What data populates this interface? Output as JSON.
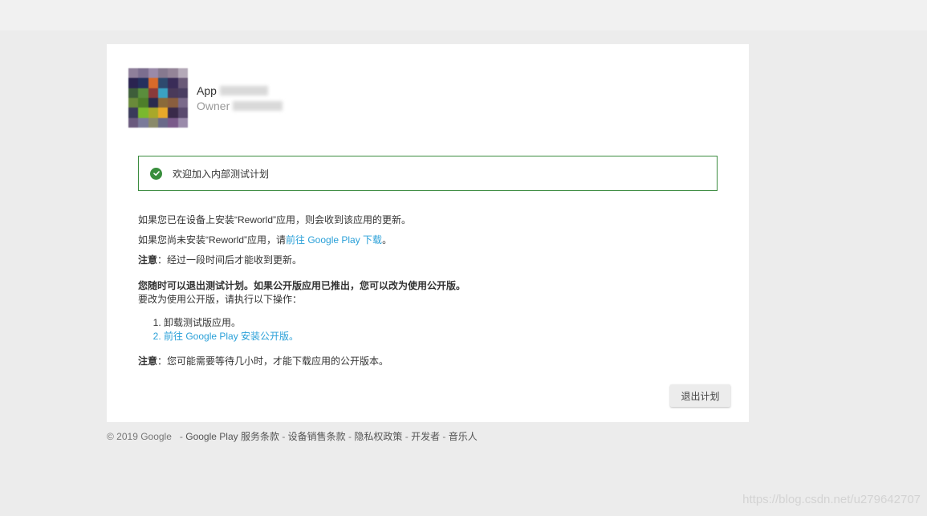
{
  "app": {
    "name": "App",
    "owner": "Owner",
    "icon_colors": [
      "#8e7f9a",
      "#7c6e8f",
      "#9a8aa8",
      "#86798f",
      "#948498",
      "#b4a9b8",
      "#2a2350",
      "#24305e",
      "#d86a2a",
      "#2e4a6e",
      "#3a2c58",
      "#6a5a78",
      "#3e5e3a",
      "#5a8e3c",
      "#8a3a3a",
      "#3aa2c2",
      "#4a3a5a",
      "#4a3e62",
      "#6a8a3a",
      "#4e7e2a",
      "#2a2a4e",
      "#8a6a3a",
      "#8a5e3e",
      "#7a6a8a",
      "#3a3a5a",
      "#7ab82e",
      "#a8a82a",
      "#e8a82a",
      "#3a2a4a",
      "#5a4a6e",
      "#6a5a7e",
      "#7a7a9a",
      "#8a8a6a",
      "#6a6a8a",
      "#7a5a8a",
      "#9a8aaa"
    ]
  },
  "banner": {
    "text": "欢迎加入内部测试计划",
    "icon": "check-circle-icon",
    "color": "#388e3c"
  },
  "content": {
    "p1": "如果您已在设备上安装“Reworld”应用，则会收到该应用的更新。",
    "p2_prefix": "如果您尚未安装“Reworld”应用，请",
    "p2_link": "前往 Google Play 下载",
    "p2_suffix": "。",
    "note_label": "注意",
    "note1_text": "：经过一段时间后才能收到更新。",
    "bold_line": "您随时可以退出测试计划。如果公开版应用已推出，您可以改为使用公开版。",
    "steps_intro": "要改为使用公开版，请执行以下操作：",
    "step1": "卸载测试版应用。",
    "step2_link": "前往 Google Play 安装公开版。",
    "note2_text": "：您可能需要等待几小时，才能下载应用的公开版本。"
  },
  "actions": {
    "exit_label": "退出计划"
  },
  "footer": {
    "copyright": "© 2019 Google",
    "links": [
      "Google Play 服务条款",
      "设备销售条款",
      "隐私权政策",
      "开发者",
      "音乐人"
    ]
  },
  "watermark": "https://blog.csdn.net/u279642707",
  "colors": {
    "link": "#2aa0d8",
    "page_bg": "#ececec",
    "card_bg": "#ffffff",
    "banner_border": "#3c8c40"
  }
}
